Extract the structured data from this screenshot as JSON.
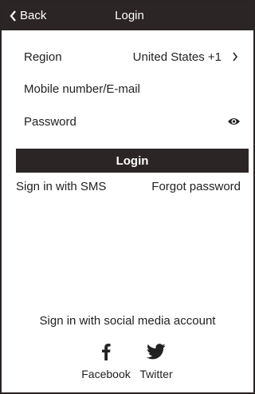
{
  "header": {
    "back_label": "Back",
    "title": "Login"
  },
  "form": {
    "region_label": "Region",
    "region_value": "United States +1",
    "mobile_placeholder": "Mobile number/E-mail",
    "password_placeholder": "Password",
    "login_label": "Login"
  },
  "links": {
    "sms": "Sign in with SMS",
    "forgot": "Forgot password"
  },
  "social": {
    "title": "Sign in with social media account",
    "facebook": "Facebook",
    "twitter": "Twitter"
  },
  "icons": [
    "chevron-left-icon",
    "chevron-right-icon",
    "eye-icon",
    "facebook-icon",
    "twitter-icon"
  ],
  "colors": {
    "dark": "#2b2525",
    "text": "#222222",
    "background": "#ffffff"
  }
}
